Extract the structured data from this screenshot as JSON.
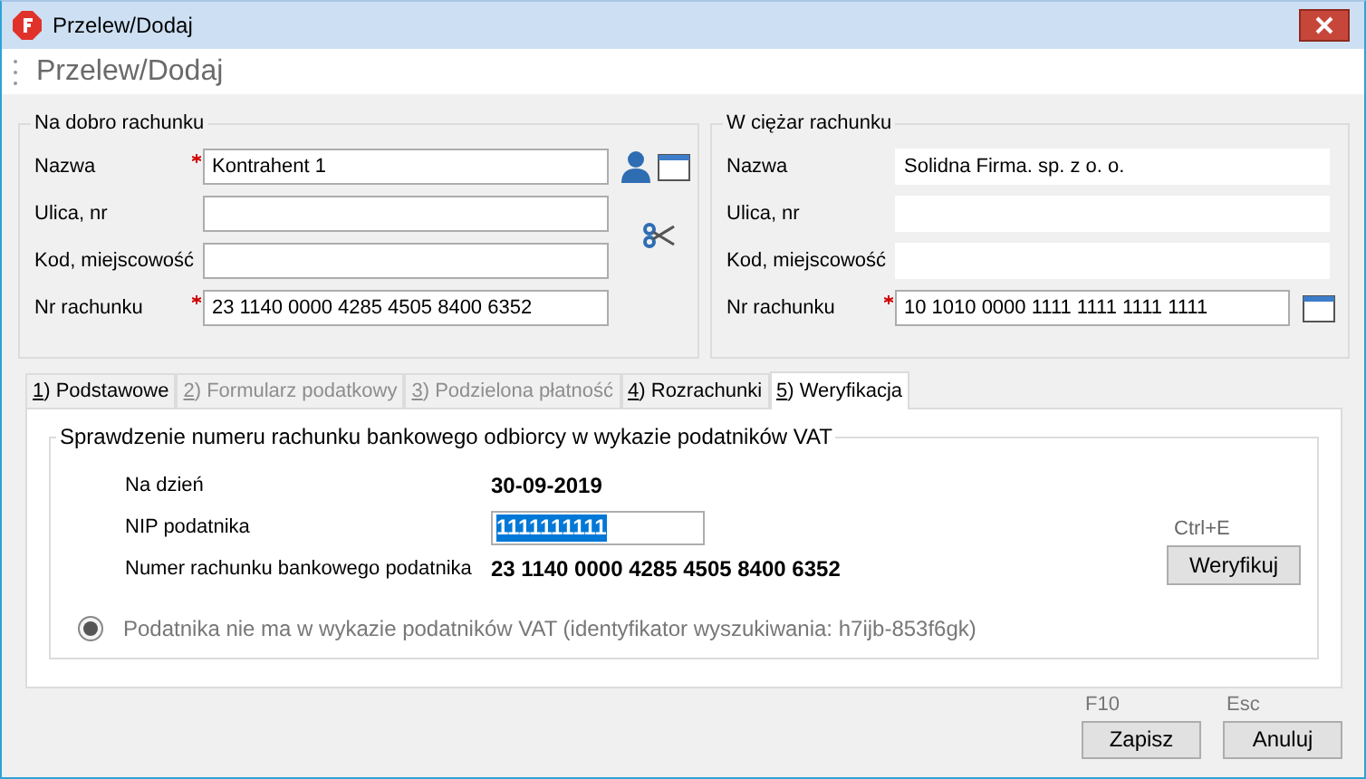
{
  "window": {
    "title": "Przelew/Dodaj"
  },
  "header": {
    "title": "Przelew/Dodaj"
  },
  "groups": [
    {
      "title": "Na dobro rachunku",
      "fields": [
        {
          "kind": "lookup",
          "label": "Nazwa",
          "required": true,
          "readonly": false,
          "value": "Kontrahent 1"
        },
        {
          "kind": "cut",
          "label": "Ulica, nr",
          "required": false,
          "readonly": false
        },
        {
          "kind": "plain",
          "label": "Kod, miejscowość",
          "required": false,
          "readonly": false
        },
        {
          "kind": "plain",
          "label": "Nr rachunku",
          "required": true,
          "readonly": false,
          "value": "23 1140 0000 4285 4505 8400 6352"
        }
      ]
    },
    {
      "title": "W ciężar rachunku",
      "fields": [
        {
          "kind": "plain",
          "label": "Nazwa",
          "required": false,
          "readonly": true,
          "value": "Solidna Firma. sp. z o. o."
        },
        {
          "kind": "plain",
          "label": "Ulica, nr",
          "required": false,
          "readonly": true
        },
        {
          "kind": "plain",
          "label": "Kod, miejscowość",
          "required": false,
          "readonly": true
        },
        {
          "kind": "browse",
          "label": "Nr rachunku",
          "required": true,
          "readonly": false,
          "value": "10 1010 0000 1111 1111 1111 1111"
        }
      ]
    }
  ],
  "tabs": [
    {
      "label": "1) Podstawowe",
      "selected": false,
      "disabled": false
    },
    {
      "label": "2) Formularz podatkowy",
      "selected": false,
      "disabled": true
    },
    {
      "label": "3) Podzielona płatność",
      "selected": false,
      "disabled": true
    },
    {
      "label": "4) Rozrachunki",
      "selected": false,
      "disabled": false
    },
    {
      "label": "5) Weryfikacja",
      "selected": true,
      "disabled": false
    }
  ],
  "verification": {
    "title": "Sprawdzenie numeru rachunku bankowego odbiorcy w wykazie podatników VAT",
    "rows": [
      {
        "kind": "text",
        "label": "Na dzień",
        "value": "30-09-2019"
      },
      {
        "kind": "input",
        "label": "NIP podatnika",
        "value": "1111111111"
      },
      {
        "kind": "text",
        "label": "Numer rachunku bankowego podatnika",
        "value": "23 1140 0000 4285 4505 8400 6352"
      }
    ],
    "shortcut": "Ctrl+E",
    "button": "Weryfikuj",
    "result": {
      "label": "Podatnika nie ma w wykazie podatników VAT (identyfikator wyszukiwania: h7ijb-853f6gk)",
      "selected": true
    }
  },
  "buttons": [
    {
      "shortcut": "F10",
      "label": "Zapisz"
    },
    {
      "shortcut": "Esc",
      "label": "Anuluj"
    }
  ]
}
